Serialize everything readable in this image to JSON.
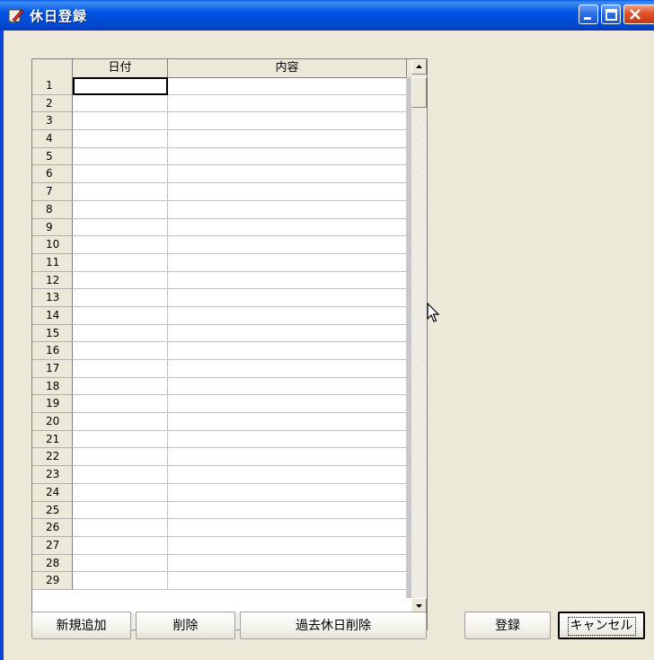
{
  "window": {
    "title": "休日登録",
    "icon": "pencil-notepad-icon"
  },
  "grid": {
    "columns": [
      "日付",
      "内容"
    ],
    "rows": [
      {
        "num": "1",
        "date": "",
        "content": ""
      },
      {
        "num": "2",
        "date": "",
        "content": ""
      },
      {
        "num": "3",
        "date": "",
        "content": ""
      },
      {
        "num": "4",
        "date": "",
        "content": ""
      },
      {
        "num": "5",
        "date": "",
        "content": ""
      },
      {
        "num": "6",
        "date": "",
        "content": ""
      },
      {
        "num": "7",
        "date": "",
        "content": ""
      },
      {
        "num": "8",
        "date": "",
        "content": ""
      },
      {
        "num": "9",
        "date": "",
        "content": ""
      },
      {
        "num": "10",
        "date": "",
        "content": ""
      },
      {
        "num": "11",
        "date": "",
        "content": ""
      },
      {
        "num": "12",
        "date": "",
        "content": ""
      },
      {
        "num": "13",
        "date": "",
        "content": ""
      },
      {
        "num": "14",
        "date": "",
        "content": ""
      },
      {
        "num": "15",
        "date": "",
        "content": ""
      },
      {
        "num": "16",
        "date": "",
        "content": ""
      },
      {
        "num": "17",
        "date": "",
        "content": ""
      },
      {
        "num": "18",
        "date": "",
        "content": ""
      },
      {
        "num": "19",
        "date": "",
        "content": ""
      },
      {
        "num": "20",
        "date": "",
        "content": ""
      },
      {
        "num": "21",
        "date": "",
        "content": ""
      },
      {
        "num": "22",
        "date": "",
        "content": ""
      },
      {
        "num": "23",
        "date": "",
        "content": ""
      },
      {
        "num": "24",
        "date": "",
        "content": ""
      },
      {
        "num": "25",
        "date": "",
        "content": ""
      },
      {
        "num": "26",
        "date": "",
        "content": ""
      },
      {
        "num": "27",
        "date": "",
        "content": ""
      },
      {
        "num": "28",
        "date": "",
        "content": ""
      },
      {
        "num": "29",
        "date": "",
        "content": ""
      }
    ]
  },
  "buttons": {
    "add_new": "新規追加",
    "delete": "削除",
    "delete_past": "過去休日削除",
    "register": "登録",
    "cancel": "キャンセル"
  }
}
